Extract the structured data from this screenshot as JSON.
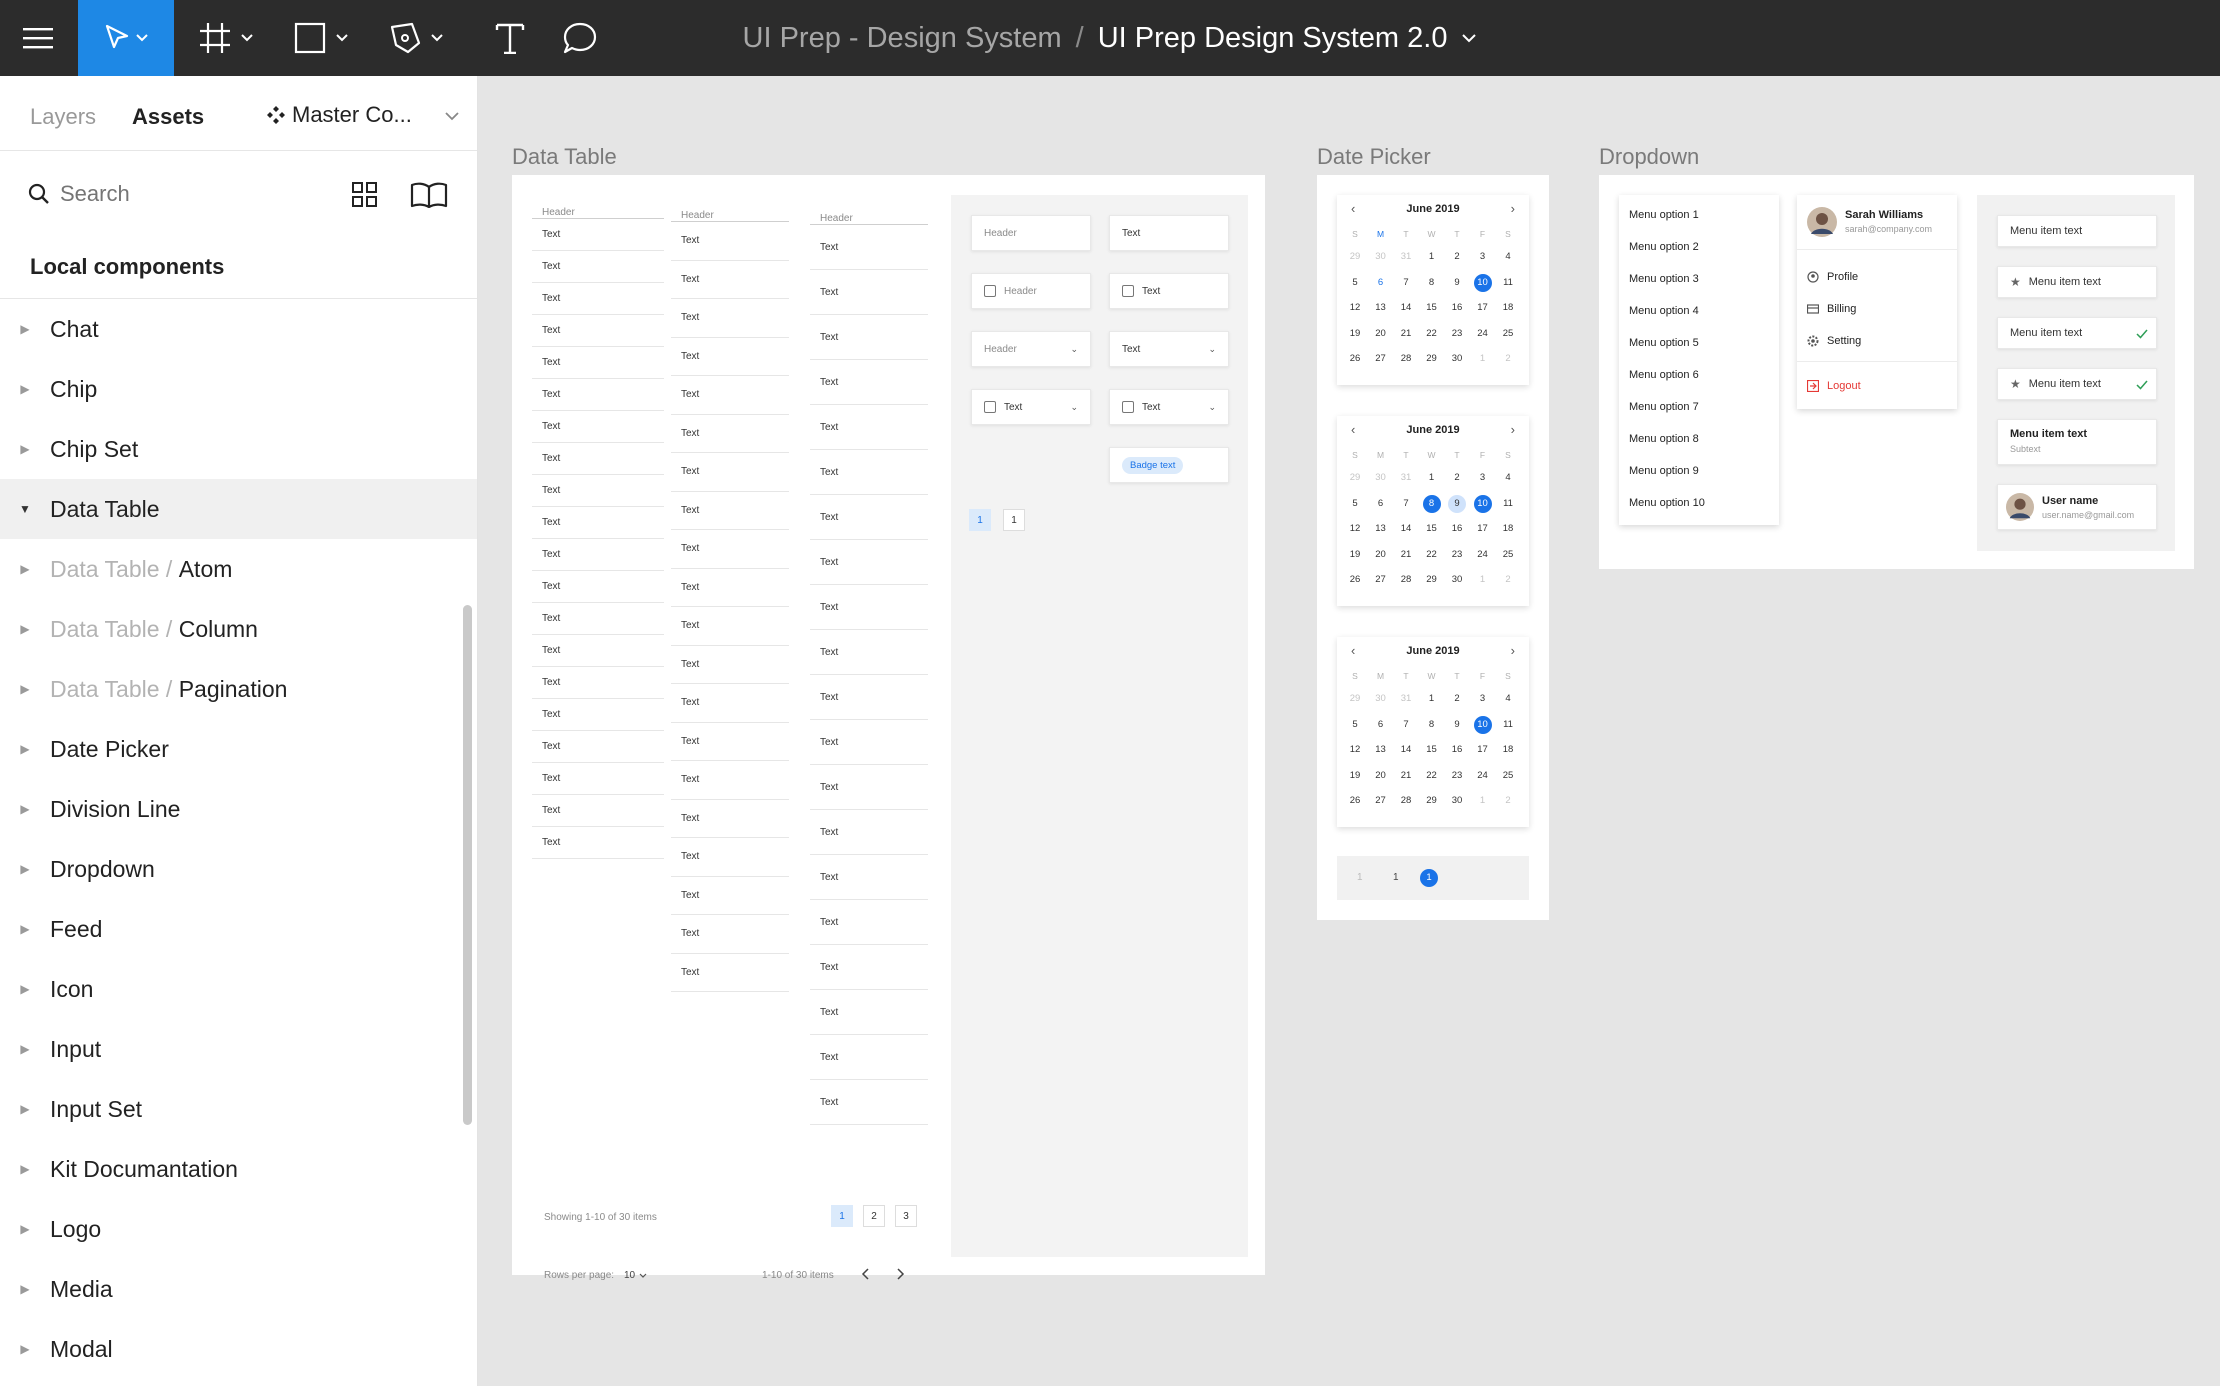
{
  "toolbar": {
    "menu_icon": "hamburger-icon",
    "tools": [
      "move-icon",
      "frame-icon",
      "shape-icon",
      "pen-icon",
      "text-icon",
      "comment-icon"
    ],
    "accent": "#1e88e5"
  },
  "title": {
    "project": "UI Prep - Design System",
    "separator": "/",
    "file": "UI Prep Design System 2.0"
  },
  "sidebar": {
    "tab_layers": "Layers",
    "tab_assets": "Assets",
    "library": "Master Co...",
    "search_placeholder": "Search",
    "section": "Local components",
    "items": [
      {
        "prefix": "",
        "label": "Chat"
      },
      {
        "prefix": "",
        "label": "Chip"
      },
      {
        "prefix": "",
        "label": "Chip Set"
      },
      {
        "prefix": "",
        "label": "Data Table"
      },
      {
        "prefix": "Data Table / ",
        "label": "Atom"
      },
      {
        "prefix": "Data Table / ",
        "label": "Column"
      },
      {
        "prefix": "Data Table / ",
        "label": "Pagination"
      },
      {
        "prefix": "",
        "label": "Date Picker"
      },
      {
        "prefix": "",
        "label": "Division Line"
      },
      {
        "prefix": "",
        "label": "Dropdown"
      },
      {
        "prefix": "",
        "label": "Feed"
      },
      {
        "prefix": "",
        "label": "Icon"
      },
      {
        "prefix": "",
        "label": "Input"
      },
      {
        "prefix": "",
        "label": "Input Set"
      },
      {
        "prefix": "",
        "label": "Kit Documantation"
      },
      {
        "prefix": "",
        "label": "Logo"
      },
      {
        "prefix": "",
        "label": "Media"
      },
      {
        "prefix": "",
        "label": "Modal"
      }
    ]
  },
  "canvas": {
    "data_table": {
      "label": "Data Table",
      "header": "Header",
      "cell": "Text",
      "showing": "Showing 1-10 of 30 items",
      "pages": [
        "1",
        "2",
        "3"
      ],
      "rows_per_page_label": "Rows per page:",
      "rows_per_page_value": "10",
      "range": "1-10 of 30 items",
      "atoms": {
        "header": "Header",
        "text": "Text",
        "badge": "Badge text",
        "page": "1"
      }
    },
    "date_picker": {
      "label": "Date Picker",
      "month": "June 2019",
      "weekdays": [
        "S",
        "M",
        "T",
        "W",
        "T",
        "F",
        "S"
      ],
      "weeks": [
        [
          "29",
          "30",
          "31",
          "1",
          "2",
          "3",
          "4"
        ],
        [
          "5",
          "6",
          "7",
          "8",
          "9",
          "10",
          "11"
        ],
        [
          "12",
          "13",
          "14",
          "15",
          "16",
          "17",
          "18"
        ],
        [
          "19",
          "20",
          "21",
          "22",
          "23",
          "24",
          "25"
        ],
        [
          "26",
          "27",
          "28",
          "29",
          "30",
          "1",
          "2"
        ]
      ],
      "pagination": [
        "1",
        "1",
        "1"
      ]
    },
    "dropdown": {
      "label": "Dropdown",
      "options": [
        "Menu option 1",
        "Menu option 2",
        "Menu option 3",
        "Menu option 4",
        "Menu option 5",
        "Menu option 6",
        "Menu option 7",
        "Menu option 8",
        "Menu option 9",
        "Menu option 10"
      ],
      "profile": {
        "name": "Sarah Williams",
        "email": "sarah@company.com",
        "items": [
          "Profile",
          "Billing",
          "Setting"
        ],
        "logout": "Logout"
      },
      "menu_items": {
        "text": "Menu item text",
        "subtext": "Subtext",
        "user_name": "User name",
        "user_email": "user.name@gmail.com"
      }
    }
  }
}
